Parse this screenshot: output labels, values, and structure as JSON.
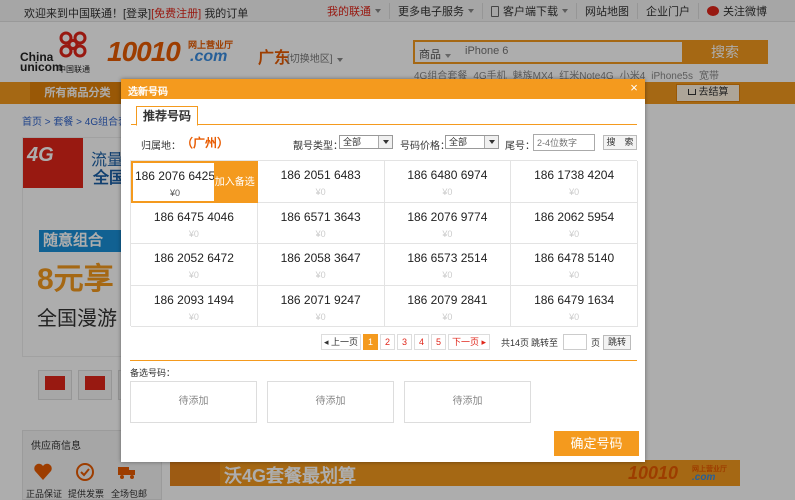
{
  "topbar": {
    "welcome": "欢迎来到中国联通！",
    "login": "[登录]",
    "register": "[免费注册]",
    "orders": "我的订单",
    "my_unicom": "我的联通",
    "more_services": "更多电子服务",
    "client_download": "客户端下载",
    "sitemap": "网站地图",
    "portal": "企业门户",
    "weibo": "关注微博"
  },
  "header": {
    "logo_china": "China",
    "logo_unicom": "unicom",
    "logo_sub": "中国联通",
    "brand": "10010",
    "brand_sub": "网上营业厅",
    "brand_com": ".com",
    "region": "广东",
    "region_switch": "[切换地区]",
    "search_category": "商品",
    "search_placeholder": "iPhone 6",
    "search_button": "搜索",
    "hot_words": [
      "4G组合套餐",
      "4G手机",
      "魅族MX4",
      "红米Note4G",
      "小米4",
      "iPhone5s",
      "宽带"
    ]
  },
  "nav": {
    "all_categories": "所有商品分类",
    "cart": "去结算"
  },
  "background": {
    "breadcrumb": "首页 > 套餐 > 4G组合套",
    "banner_4g": "4G",
    "banner_liu": "流量",
    "banner_quan": "全国",
    "banner_stripe": "随意组合",
    "banner_yuan": "8元享",
    "banner_roam": "全国漫游",
    "supplier_title": "供应商信息",
    "supplier_items": [
      "正品保证",
      "提供发票",
      "全场包邮"
    ],
    "calc_title": "沃4G套餐最划算",
    "calc_brand": "10010",
    "calc_brand_sub": "网上营业厅",
    "calc_brand_com": ".com"
  },
  "modal": {
    "title": "选新号码",
    "close": "×",
    "tab": "推荐号码",
    "filters": {
      "location_label": "归属地：",
      "location_value": "（广州）",
      "type_label": "靓号类型：",
      "type_value": "全部",
      "price_label": "号码价格：",
      "price_value": "全部",
      "tail_label": "尾号：",
      "tail_placeholder": "2-4位数字",
      "search_button": "搜　索"
    },
    "numbers": [
      {
        "number": "186 2076 6425",
        "price": "¥0",
        "selected": true
      },
      {
        "number": "186  2051  6483",
        "price": "¥0"
      },
      {
        "number": "186  6480  6974",
        "price": "¥0"
      },
      {
        "number": "186  1738  4204",
        "price": "¥0"
      },
      {
        "number": "186  6475  4046",
        "price": "¥0"
      },
      {
        "number": "186  6571 3643",
        "price": "¥0"
      },
      {
        "number": "186  2076  9774",
        "price": "¥0"
      },
      {
        "number": "186  2062  5954",
        "price": "¥0"
      },
      {
        "number": "186  2052  6472",
        "price": "¥0"
      },
      {
        "number": "186  2058 3647",
        "price": "¥0"
      },
      {
        "number": "186  6573 2514",
        "price": "¥0"
      },
      {
        "number": "186  6478  5140",
        "price": "¥0"
      },
      {
        "number": "186  2093  1494",
        "price": "¥0"
      },
      {
        "number": "186  2071 9247",
        "price": "¥0"
      },
      {
        "number": "186  2079 2841",
        "price": "¥0"
      },
      {
        "number": "186  6479 1634",
        "price": "¥0"
      }
    ],
    "add_candidate": "加入备选",
    "pager": {
      "prev": "◂ 上一页",
      "pages": [
        "1",
        "2",
        "3",
        "4",
        "5"
      ],
      "current": "1",
      "next": "下一页 ▸",
      "total": "共14页",
      "jump_to": "跳转至",
      "page_unit": "页",
      "go": "跳转"
    },
    "candidates_label": "备选号码：",
    "candidate_slots": [
      "待添加",
      "待添加",
      "待添加"
    ],
    "confirm": "确定号码"
  },
  "colors": {
    "accent": "#f49a1e",
    "brand_orange": "#e85b00",
    "unicom_red": "#e0261a"
  }
}
